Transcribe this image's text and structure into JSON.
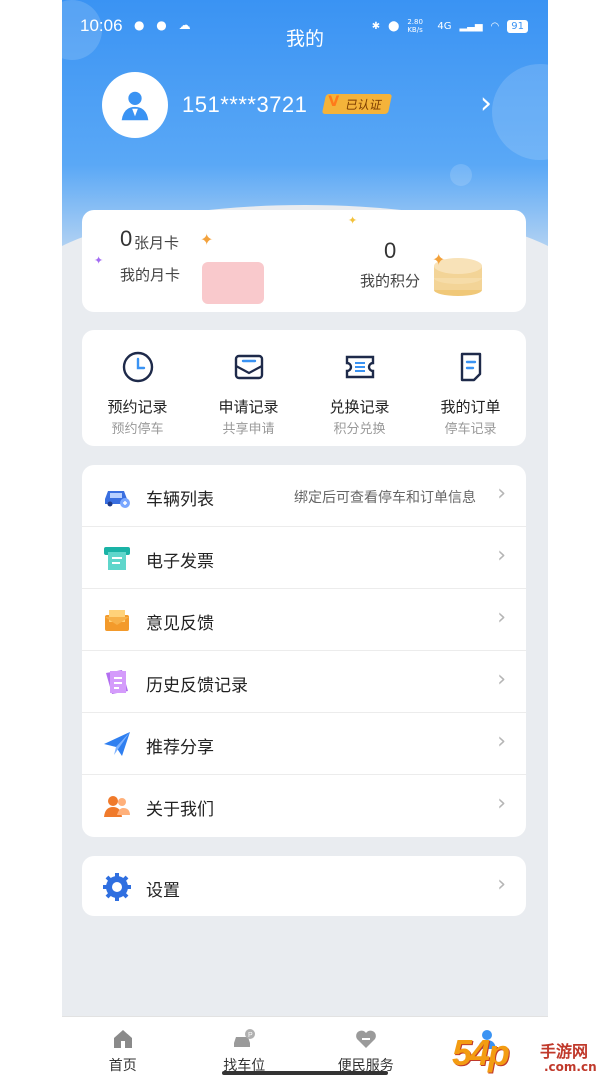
{
  "status_bar": {
    "time": "10:06",
    "battery": "91",
    "net_speed": "2.80 KB/s",
    "signal": "4G"
  },
  "header": {
    "title": "我的"
  },
  "profile": {
    "phone": "151****3721",
    "verified_badge": "已认证"
  },
  "stats": {
    "month_card_count": "0",
    "month_card_unit": "张月卡",
    "month_card_label": "我的月卡",
    "points_value": "0",
    "points_label": "我的积分"
  },
  "quick_actions": [
    {
      "title": "预约记录",
      "subtitle": "预约停车",
      "icon": "clock-icon"
    },
    {
      "title": "申请记录",
      "subtitle": "共享申请",
      "icon": "mail-icon"
    },
    {
      "title": "兑换记录",
      "subtitle": "积分兑换",
      "icon": "ticket-icon"
    },
    {
      "title": "我的订单",
      "subtitle": "停车记录",
      "icon": "order-icon"
    }
  ],
  "menu": [
    {
      "label": "车辆列表",
      "hint": "绑定后可查看停车和订单信息",
      "icon": "car-icon"
    },
    {
      "label": "电子发票",
      "hint": "",
      "icon": "invoice-icon"
    },
    {
      "label": "意见反馈",
      "hint": "",
      "icon": "feedback-icon"
    },
    {
      "label": "历史反馈记录",
      "hint": "",
      "icon": "history-icon"
    },
    {
      "label": "推荐分享",
      "hint": "",
      "icon": "share-icon"
    },
    {
      "label": "关于我们",
      "hint": "",
      "icon": "about-icon"
    }
  ],
  "settings": {
    "label": "设置"
  },
  "tabbar": [
    {
      "label": "首页",
      "icon": "home-icon"
    },
    {
      "label": "找车位",
      "icon": "parking-icon"
    },
    {
      "label": "便民服务",
      "icon": "service-icon"
    },
    {
      "label": "",
      "icon": "profile-icon"
    }
  ],
  "watermark": {
    "main": "54p",
    "cn": "手游网",
    "url": ".com.cn"
  },
  "colors": {
    "accent": "#3a93f3",
    "badge": "#f4b33a",
    "text": "#222222",
    "muted": "#999999"
  }
}
